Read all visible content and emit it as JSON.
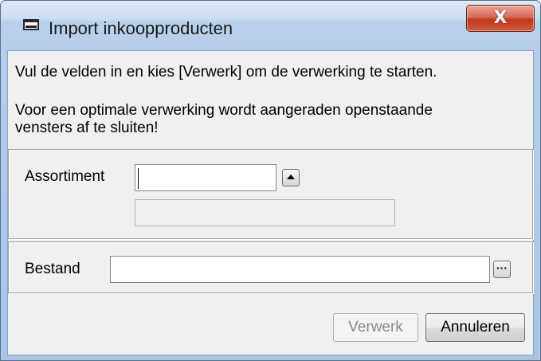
{
  "window": {
    "title": "Import inkoopproducten",
    "app_icon": "dialog-window-icon",
    "close_icon": "close-icon",
    "close_glyph": "X"
  },
  "intro": {
    "line1": "Vul de velden in en kies [Verwerk] om de verwerking te starten.",
    "line2": "Voor een optimale verwerking wordt aangeraden openstaande",
    "line3": "vensters af te sluiten!"
  },
  "assortiment": {
    "label": "Assortiment",
    "value": "",
    "description": "",
    "lookup_icon": "triangle-up-icon"
  },
  "bestand": {
    "label": "Bestand",
    "value": "",
    "browse_icon": "ellipsis-icon",
    "browse_glyph": "···"
  },
  "buttons": {
    "verwerk": "Verwerk",
    "annuleren": "Annuleren"
  },
  "colors": {
    "title_bar": "#c9dcf1",
    "close_button": "#c4371b",
    "client_background": "#f0f0f0",
    "disabled_text": "#8a8a8a"
  }
}
